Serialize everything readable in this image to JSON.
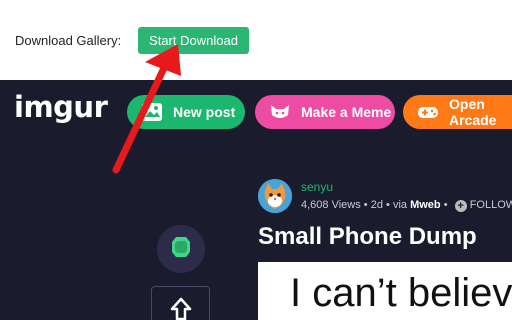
{
  "top_bar": {
    "label": "Download Gallery:",
    "button_label": "Start Download"
  },
  "header": {
    "logo": "imgur",
    "buttons": [
      {
        "label": "New post",
        "icon": "image-plus-icon",
        "color": "#1bb76e"
      },
      {
        "label": "Make a Meme",
        "icon": "cat-icon",
        "color": "#ee4ba2"
      },
      {
        "label": "Open Arcade",
        "icon": "gamepad-icon",
        "color": "#ff7a17"
      }
    ]
  },
  "post": {
    "username": "senyu",
    "views": "4,608 Views",
    "age": "2d",
    "via_prefix": "via",
    "via": "Mweb",
    "follow": "FOLLOW",
    "title": "Small Phone Dump",
    "image_text": "I can’t believe"
  },
  "sidebar": {
    "gem_icon": "emerald-icon",
    "up_icon": "upvote-arrow-icon"
  },
  "annotation": {
    "arrow_color": "#e8191b"
  }
}
